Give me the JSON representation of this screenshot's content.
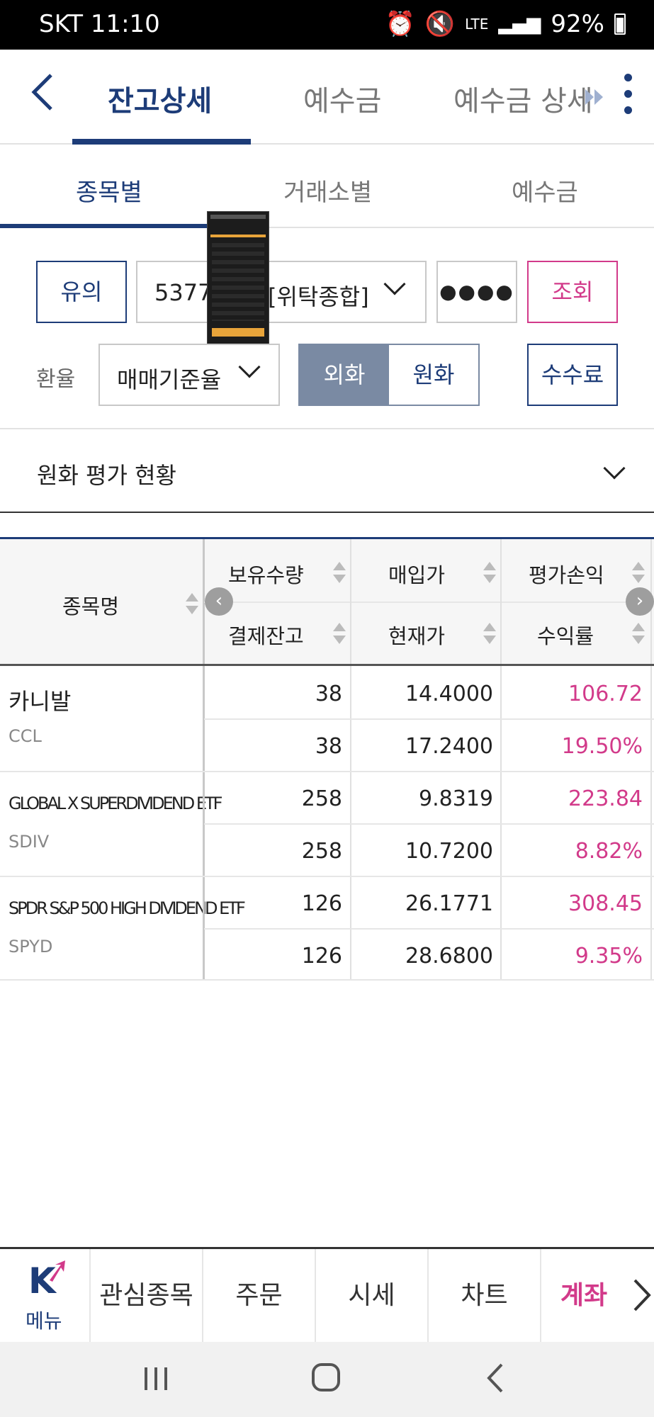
{
  "status_bar": {
    "carrier_time": "SKT 11:10",
    "network": "LTE",
    "battery": "92%"
  },
  "top_tabs": [
    {
      "label": "잔고상세",
      "active": true
    },
    {
      "label": "예수금",
      "active": false
    },
    {
      "label": "예수금 상세",
      "active": false
    }
  ],
  "sub_tabs": [
    {
      "label": "종목별",
      "active": true
    },
    {
      "label": "거래소별",
      "active": false
    },
    {
      "label": "예수금",
      "active": false
    }
  ],
  "controls": {
    "notice_button": "유의",
    "account_partial": "5377",
    "account_type": "[위탁종합]",
    "password_mask": "●●●●",
    "search_button": "조회",
    "exchange_label": "환율",
    "exchange_value": "매매기준율",
    "currency_foreign": "외화",
    "currency_krw": "원화",
    "fee_button": "수수료"
  },
  "summary": {
    "title": "원화 평가 현황"
  },
  "table": {
    "headers": {
      "name": "종목명",
      "holding_qty": "보유수량",
      "purchase_price": "매입가",
      "eval_pl": "평가손익",
      "settle_balance": "결제잔고",
      "current_price": "현재가",
      "return_rate": "수익률"
    },
    "rows": [
      {
        "name": "카니발",
        "code": "CCL",
        "qty": "38",
        "purchase": "14.4000",
        "pl": "106.72",
        "settle": "38",
        "current": "17.2400",
        "rate": "19.50%"
      },
      {
        "name": "GLOBAL X SUPERDIVIDEND ETF",
        "code": "SDIV",
        "qty": "258",
        "purchase": "9.8319",
        "pl": "223.84",
        "settle": "258",
        "current": "10.7200",
        "rate": "8.82%"
      },
      {
        "name": "SPDR S&P 500 HIGH DIVIDEND ETF",
        "code": "SPYD",
        "qty": "126",
        "purchase": "26.1771",
        "pl": "308.45",
        "settle": "126",
        "current": "28.6800",
        "rate": "9.35%"
      }
    ]
  },
  "bottom_nav": {
    "menu": "메뉴",
    "items": [
      "관심종목",
      "주문",
      "시세",
      "차트",
      "계좌"
    ],
    "active": "계좌"
  },
  "colors": {
    "navy": "#1d3c78",
    "pink": "#d23a8a",
    "toggle_active": "#7a8aa3"
  }
}
